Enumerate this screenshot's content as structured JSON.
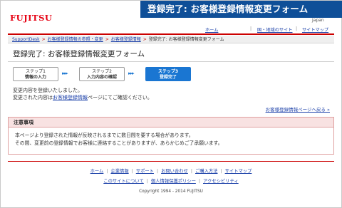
{
  "banner": {
    "title": "登録完了: お客様登録情報変更フォーム"
  },
  "header": {
    "logo": "FUJITSU",
    "region": "Japan",
    "links": {
      "home": "ホーム",
      "sep": "|",
      "global": "国・地域のサイト",
      "sitemap": "サイトマップ"
    }
  },
  "breadcrumb": {
    "items": [
      "SupportDesk",
      "お客様登録情報の参照・変更",
      "お客様登録情報",
      "登録完了: お客様登録情報変更フォーム"
    ],
    "arrow": ">"
  },
  "page_title": "登録完了: お客様登録情報変更フォーム",
  "steps": [
    {
      "num": "ステップ1",
      "label": "情報の入力"
    },
    {
      "num": "ステップ2",
      "label": "入力内容の確認"
    },
    {
      "num": "ステップ3",
      "label": "登録完了"
    }
  ],
  "step_arrows": "▸▸▸",
  "message": {
    "line1": "変更内容を登録いたしました。",
    "line2_pre": "変更された内容は",
    "line2_link": "お客様登録情報",
    "line2_post": "ページにてご確認ください。"
  },
  "back_link": "お客様登録情報ページへ戻る »",
  "notice": {
    "heading": "注意事項",
    "line1": "本ページより登録された情報が反映されるまでに数日間を要する場合があります。",
    "line2": "その間、変更前の登録情報でお客様に連絡することがありますが、あらかじめご了承願います。"
  },
  "footer": {
    "row1": [
      "ホーム",
      "企業情報",
      "サポート",
      "お問い合わせ",
      "ご購入方法",
      "サイトマップ"
    ],
    "row2": [
      "このサイトについて",
      "個人情報保護ポリシー",
      "アクセシビリティ"
    ],
    "sep": "|",
    "copyright": "Copyright 1994 - 2014 FUJITSU"
  }
}
